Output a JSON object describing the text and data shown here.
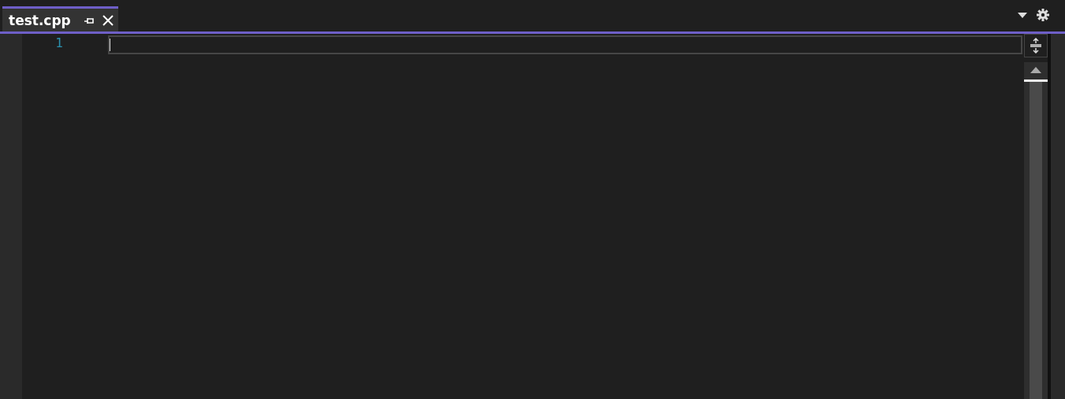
{
  "tabs": [
    {
      "label": "test.cpp",
      "selected": true
    }
  ],
  "editor": {
    "line_numbers": [
      "1"
    ]
  }
}
